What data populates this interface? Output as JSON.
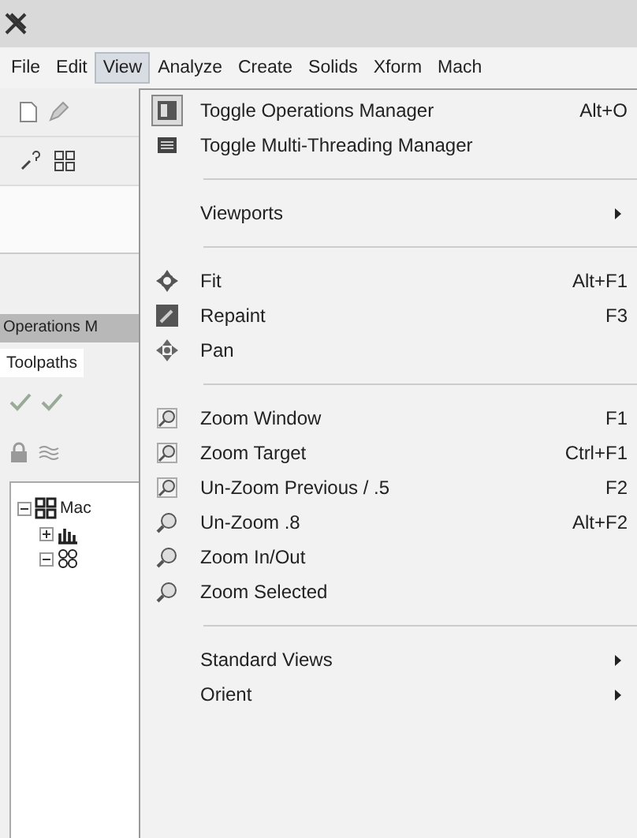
{
  "menubar": [
    {
      "label": "File",
      "selected": false
    },
    {
      "label": "Edit",
      "selected": false
    },
    {
      "label": "View",
      "selected": true
    },
    {
      "label": "Analyze",
      "selected": false
    },
    {
      "label": "Create",
      "selected": false
    },
    {
      "label": "Solids",
      "selected": false
    },
    {
      "label": "Xform",
      "selected": false
    },
    {
      "label": "Mach",
      "selected": false
    }
  ],
  "panel": {
    "title": "Operations M",
    "tab": "Toolpaths",
    "tree": {
      "label": "Mac",
      "expanded": true,
      "children": [
        {
          "expanded": false
        },
        {
          "expanded": true
        }
      ]
    }
  },
  "menu": [
    {
      "kind": "command",
      "label": "Toggle Operations Manager",
      "shortcut": "Alt+O",
      "checked": true
    },
    {
      "kind": "command",
      "label": "Toggle Multi-Threading Manager",
      "checked": false
    },
    {
      "kind": "separator"
    },
    {
      "kind": "submenu",
      "label": "Viewports"
    },
    {
      "kind": "separator"
    },
    {
      "kind": "command",
      "label": "Fit",
      "shortcut": "Alt+F1",
      "checked": false
    },
    {
      "kind": "command",
      "label": "Repaint",
      "shortcut": "F3",
      "checked": false
    },
    {
      "kind": "command",
      "label": "Pan",
      "checked": false
    },
    {
      "kind": "separator"
    },
    {
      "kind": "command",
      "label": "Zoom Window",
      "shortcut": "F1",
      "checked": false
    },
    {
      "kind": "command",
      "label": "Zoom Target",
      "shortcut": "Ctrl+F1",
      "checked": false
    },
    {
      "kind": "command",
      "label": "Un-Zoom Previous / .5",
      "shortcut": "F2",
      "checked": false
    },
    {
      "kind": "command",
      "label": "Un-Zoom .8",
      "shortcut": "Alt+F2",
      "checked": false
    },
    {
      "kind": "command",
      "label": "Zoom In/Out",
      "checked": false
    },
    {
      "kind": "command",
      "label": "Zoom Selected",
      "checked": false
    },
    {
      "kind": "separator"
    },
    {
      "kind": "submenu",
      "label": "Standard Views"
    },
    {
      "kind": "submenu",
      "label": "Orient"
    }
  ]
}
